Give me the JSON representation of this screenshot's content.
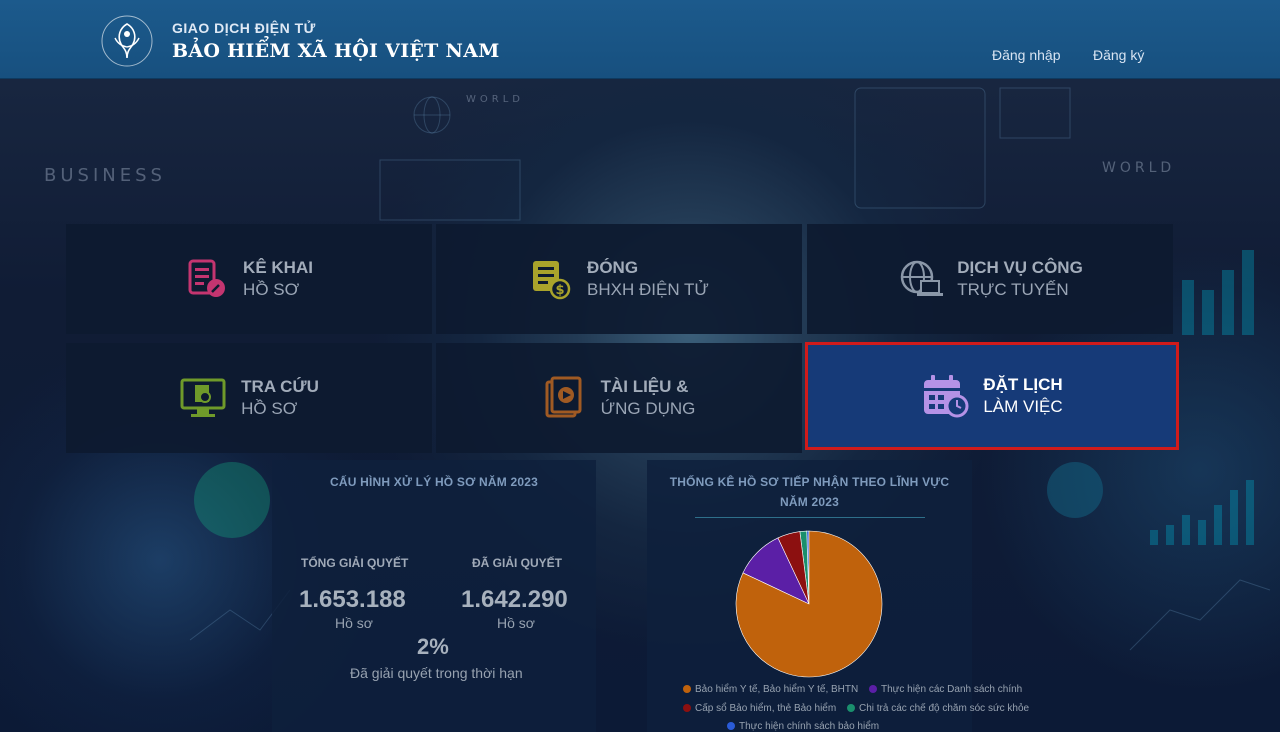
{
  "header": {
    "brand_top": "GIAO DỊCH ĐIỆN TỬ",
    "brand_main": "BẢO HIỂM XÃ HỘI VIỆT NAM",
    "logo_text": "BẢO HIỂM XÃ HỘI VIỆT NAM",
    "login": "Đăng nhập",
    "register": "Đăng ký"
  },
  "background": {
    "business": "BUSINESS",
    "world_left": "WORLD",
    "world_right": "WORLD"
  },
  "tiles": [
    {
      "line1": "KÊ KHAI",
      "line2": "HỒ SƠ",
      "icon": "document-edit-icon",
      "color": "#c43570"
    },
    {
      "line1": "ĐÓNG",
      "line2": "BHXH ĐIỆN TỬ",
      "icon": "money-document-icon",
      "color": "#a9a32b"
    },
    {
      "line1": "DỊCH VỤ CÔNG",
      "line2": "TRỰC TUYẾN",
      "icon": "globe-laptop-icon",
      "color": "#8a97a8"
    },
    {
      "line1": "TRA CỨU",
      "line2": "HỒ SƠ",
      "icon": "monitor-search-icon",
      "color": "#6f9a2a"
    },
    {
      "line1": "TÀI LIỆU &",
      "line2": "ỨNG DỤNG",
      "icon": "media-book-icon",
      "color": "#a05a23"
    },
    {
      "line1": "ĐẶT LỊCH",
      "line2": "LÀM VIỆC",
      "icon": "calendar-clock-icon",
      "color": "#b592e6"
    }
  ],
  "processing": {
    "title": "CẤU HÌNH XỬ LÝ HỒ SƠ NĂM 2023",
    "total_label": "TỔNG GIẢI QUYẾT",
    "total_value": "1.653.188",
    "total_unit": "Hồ sơ",
    "solved_label": "ĐÃ GIẢI QUYẾT",
    "solved_value": "1.642.290",
    "solved_unit": "Hồ sơ",
    "percent": "2%",
    "percent_label": "Đã giải quyết trong thời hạn"
  },
  "stats": {
    "title_line1": "THỐNG KÊ HỒ SƠ TIẾP NHẬN THEO LĨNH VỰC",
    "title_line2": "NĂM 2023"
  },
  "chart_data": {
    "type": "pie",
    "title": "THỐNG KÊ HỒ SƠ TIẾP NHẬN THEO LĨNH VỰC NĂM 2023",
    "series": [
      {
        "name": "Bảo hiểm Y tế, Bảo hiểm Y tế, BHTN",
        "value": 82,
        "color": "#c0620c"
      },
      {
        "name": "Thực hiện các Danh sách chính",
        "value": 11,
        "color": "#5b1fa6"
      },
      {
        "name": "Cấp sổ Bảo hiểm, thẻ Bảo hiểm",
        "value": 5,
        "color": "#8c1010"
      },
      {
        "name": "Chi trả các chế độ chăm sóc sức khỏe",
        "value": 1.5,
        "color": "#1a8f6d"
      },
      {
        "name": "Thực hiện chính sách bảo hiểm",
        "value": 0.5,
        "color": "#2a5bd7"
      }
    ],
    "legend": "bottom"
  }
}
